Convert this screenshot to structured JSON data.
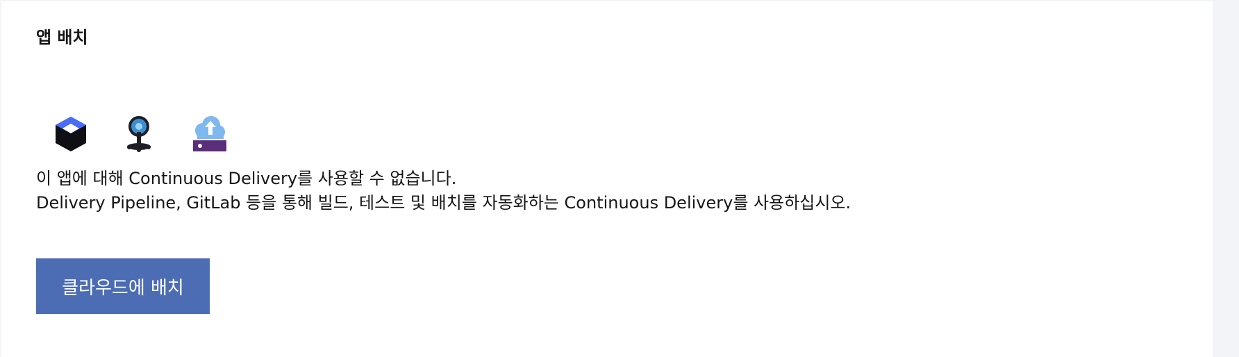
{
  "section": {
    "title": "앱 배치"
  },
  "icons": [
    {
      "name": "delivery-pipeline-icon"
    },
    {
      "name": "gitlab-icon"
    },
    {
      "name": "cloud-deploy-icon"
    }
  ],
  "message": {
    "line1": "이 앱에 대해 Continuous Delivery를 사용할 수 없습니다.",
    "line2": "Delivery Pipeline, GitLab 등을 통해 빌드, 테스트 및 배치를 자동화하는 Continuous Delivery를 사용하십시오."
  },
  "actions": {
    "deploy_label": "클라우드에 배치"
  },
  "colors": {
    "button_bg": "#4c6db4",
    "pipeline_blue": "#4a6cf7",
    "toolchain_blue": "#3b8fd1",
    "cloud_blue": "#7fb8ee",
    "server_purple": "#5b2d7a"
  }
}
